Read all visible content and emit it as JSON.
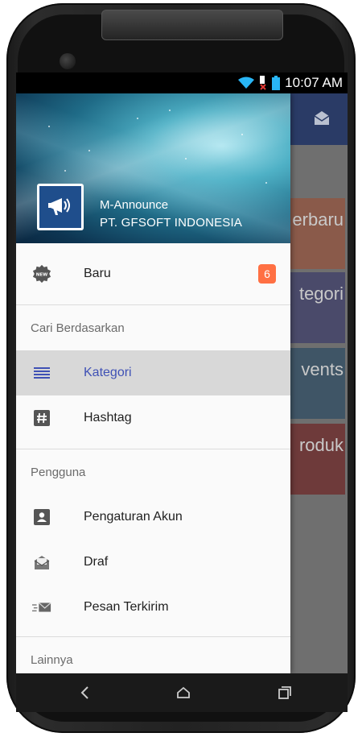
{
  "status_bar": {
    "time": "10:07 AM",
    "icons": [
      "wifi-icon",
      "signal-icon",
      "battery-icon"
    ]
  },
  "drawer": {
    "header": {
      "app_name": "M-Announce",
      "company": "PT. GFSOFT INDONESIA",
      "logo_icon": "megaphone-icon"
    },
    "items_top": [
      {
        "label": "Baru",
        "icon": "new-badge-icon",
        "badge": "6"
      }
    ],
    "section_search": {
      "title": "Cari Berdasarkan",
      "items": [
        {
          "label": "Kategori",
          "icon": "list-icon",
          "active": true
        },
        {
          "label": "Hashtag",
          "icon": "hashtag-icon",
          "active": false
        }
      ]
    },
    "section_user": {
      "title": "Pengguna",
      "items": [
        {
          "label": "Pengaturan Akun",
          "icon": "account-icon"
        },
        {
          "label": "Draf",
          "icon": "draft-icon"
        },
        {
          "label": "Pesan Terkirim",
          "icon": "sent-icon"
        }
      ]
    },
    "section_other": {
      "title": "Lainnya"
    }
  },
  "background": {
    "tiles": [
      {
        "label": "erbaru",
        "color": "#8a5a4a"
      },
      {
        "label": "tegori",
        "color": "#4a4a6a"
      },
      {
        "label": "vents",
        "color": "#3f5566"
      },
      {
        "label": "roduk",
        "color": "#6e3a3a"
      }
    ]
  },
  "nav_bar": {
    "icons": [
      "back-icon",
      "home-icon",
      "recents-icon"
    ]
  },
  "colors": {
    "accent": "#3f51b5",
    "badge": "#ff7043",
    "topbar": "#2a3b66"
  }
}
